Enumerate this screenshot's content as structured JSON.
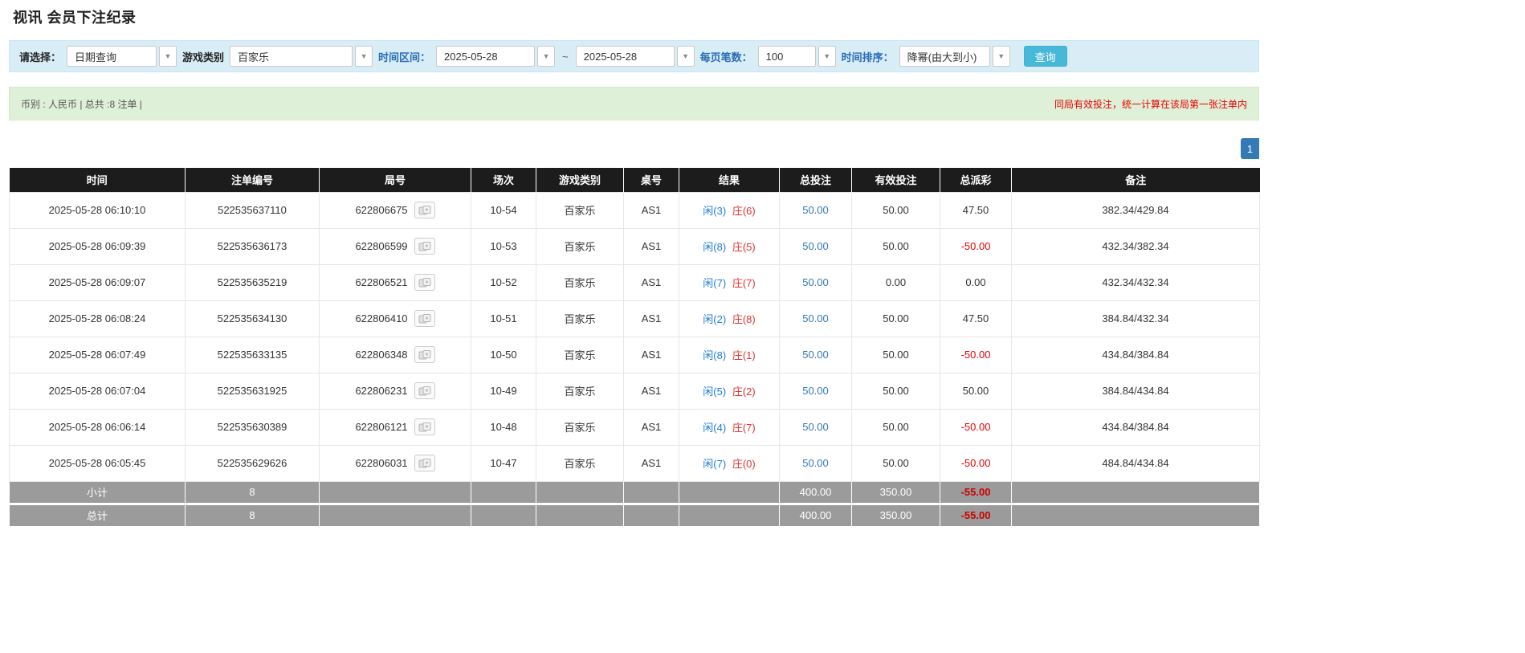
{
  "page": {
    "title": "视讯 会员下注纪录"
  },
  "colors": {
    "accent_blue": "#337ab7",
    "negative_red": "#e60000",
    "player_blue": "#1e7bd9",
    "banker_red": "#e43333",
    "table_header_bg": "#1c1c1c",
    "filter_bar_bg": "#d9edf7",
    "info_bar_bg": "#dff0d8",
    "search_button_bg": "#48b8d8",
    "summary_row_bg": "#9b9b9b"
  },
  "filters": {
    "select_label": "请选择：",
    "select_value": "日期查询",
    "game_type_label": "游戏类别",
    "game_type_value": "百家乐",
    "date_range_label": "时间区间：",
    "date_from": "2025-05-28",
    "date_tilde": "~",
    "date_to": "2025-05-28",
    "page_size_label": "每页笔数：",
    "page_size_value": "100",
    "sort_label": "时间排序：",
    "sort_value": "降幂(由大到小)",
    "search_button": "查询",
    "dropdown_arrow": "▼"
  },
  "summary_bar": {
    "left": "币别 : 人民币 | 总共 :8 注单 |",
    "right": "同局有效投注，统一计算在该局第一张注单内"
  },
  "pagination": {
    "current": "1"
  },
  "table": {
    "headers": [
      "时间",
      "注单编号",
      "局号",
      "场次",
      "游戏类别",
      "桌号",
      "结果",
      "总投注",
      "有效投注",
      "总派彩",
      "备注"
    ],
    "rows": [
      {
        "time": "2025-05-28 06:10:10",
        "bet_id": "522535637110",
        "round_id": "622806675",
        "session": "10-54",
        "game": "百家乐",
        "table_no": "AS1",
        "result_player": "闲(3)",
        "result_banker": "庄(6)",
        "total_bet": "50.00",
        "valid_bet": "50.00",
        "payout": "47.50",
        "remark": "382.34/429.84"
      },
      {
        "time": "2025-05-28 06:09:39",
        "bet_id": "522535636173",
        "round_id": "622806599",
        "session": "10-53",
        "game": "百家乐",
        "table_no": "AS1",
        "result_player": "闲(8)",
        "result_banker": "庄(5)",
        "total_bet": "50.00",
        "valid_bet": "50.00",
        "payout": "-50.00",
        "remark": "432.34/382.34"
      },
      {
        "time": "2025-05-28 06:09:07",
        "bet_id": "522535635219",
        "round_id": "622806521",
        "session": "10-52",
        "game": "百家乐",
        "table_no": "AS1",
        "result_player": "闲(7)",
        "result_banker": "庄(7)",
        "total_bet": "50.00",
        "valid_bet": "0.00",
        "payout": "0.00",
        "remark": "432.34/432.34"
      },
      {
        "time": "2025-05-28 06:08:24",
        "bet_id": "522535634130",
        "round_id": "622806410",
        "session": "10-51",
        "game": "百家乐",
        "table_no": "AS1",
        "result_player": "闲(2)",
        "result_banker": "庄(8)",
        "total_bet": "50.00",
        "valid_bet": "50.00",
        "payout": "47.50",
        "remark": "384.84/432.34"
      },
      {
        "time": "2025-05-28 06:07:49",
        "bet_id": "522535633135",
        "round_id": "622806348",
        "session": "10-50",
        "game": "百家乐",
        "table_no": "AS1",
        "result_player": "闲(8)",
        "result_banker": "庄(1)",
        "total_bet": "50.00",
        "valid_bet": "50.00",
        "payout": "-50.00",
        "remark": "434.84/384.84"
      },
      {
        "time": "2025-05-28 06:07:04",
        "bet_id": "522535631925",
        "round_id": "622806231",
        "session": "10-49",
        "game": "百家乐",
        "table_no": "AS1",
        "result_player": "闲(5)",
        "result_banker": "庄(2)",
        "total_bet": "50.00",
        "valid_bet": "50.00",
        "payout": "50.00",
        "remark": "384.84/434.84"
      },
      {
        "time": "2025-05-28 06:06:14",
        "bet_id": "522535630389",
        "round_id": "622806121",
        "session": "10-48",
        "game": "百家乐",
        "table_no": "AS1",
        "result_player": "闲(4)",
        "result_banker": "庄(7)",
        "total_bet": "50.00",
        "valid_bet": "50.00",
        "payout": "-50.00",
        "remark": "434.84/384.84"
      },
      {
        "time": "2025-05-28 06:05:45",
        "bet_id": "522535629626",
        "round_id": "622806031",
        "session": "10-47",
        "game": "百家乐",
        "table_no": "AS1",
        "result_player": "闲(7)",
        "result_banker": "庄(0)",
        "total_bet": "50.00",
        "valid_bet": "50.00",
        "payout": "-50.00",
        "remark": "484.84/434.84"
      }
    ],
    "subtotal": {
      "label": "小计",
      "count": "8",
      "total_bet": "400.00",
      "valid_bet": "350.00",
      "payout": "-55.00"
    },
    "total": {
      "label": "总计",
      "count": "8",
      "total_bet": "400.00",
      "valid_bet": "350.00",
      "payout": "-55.00"
    }
  }
}
